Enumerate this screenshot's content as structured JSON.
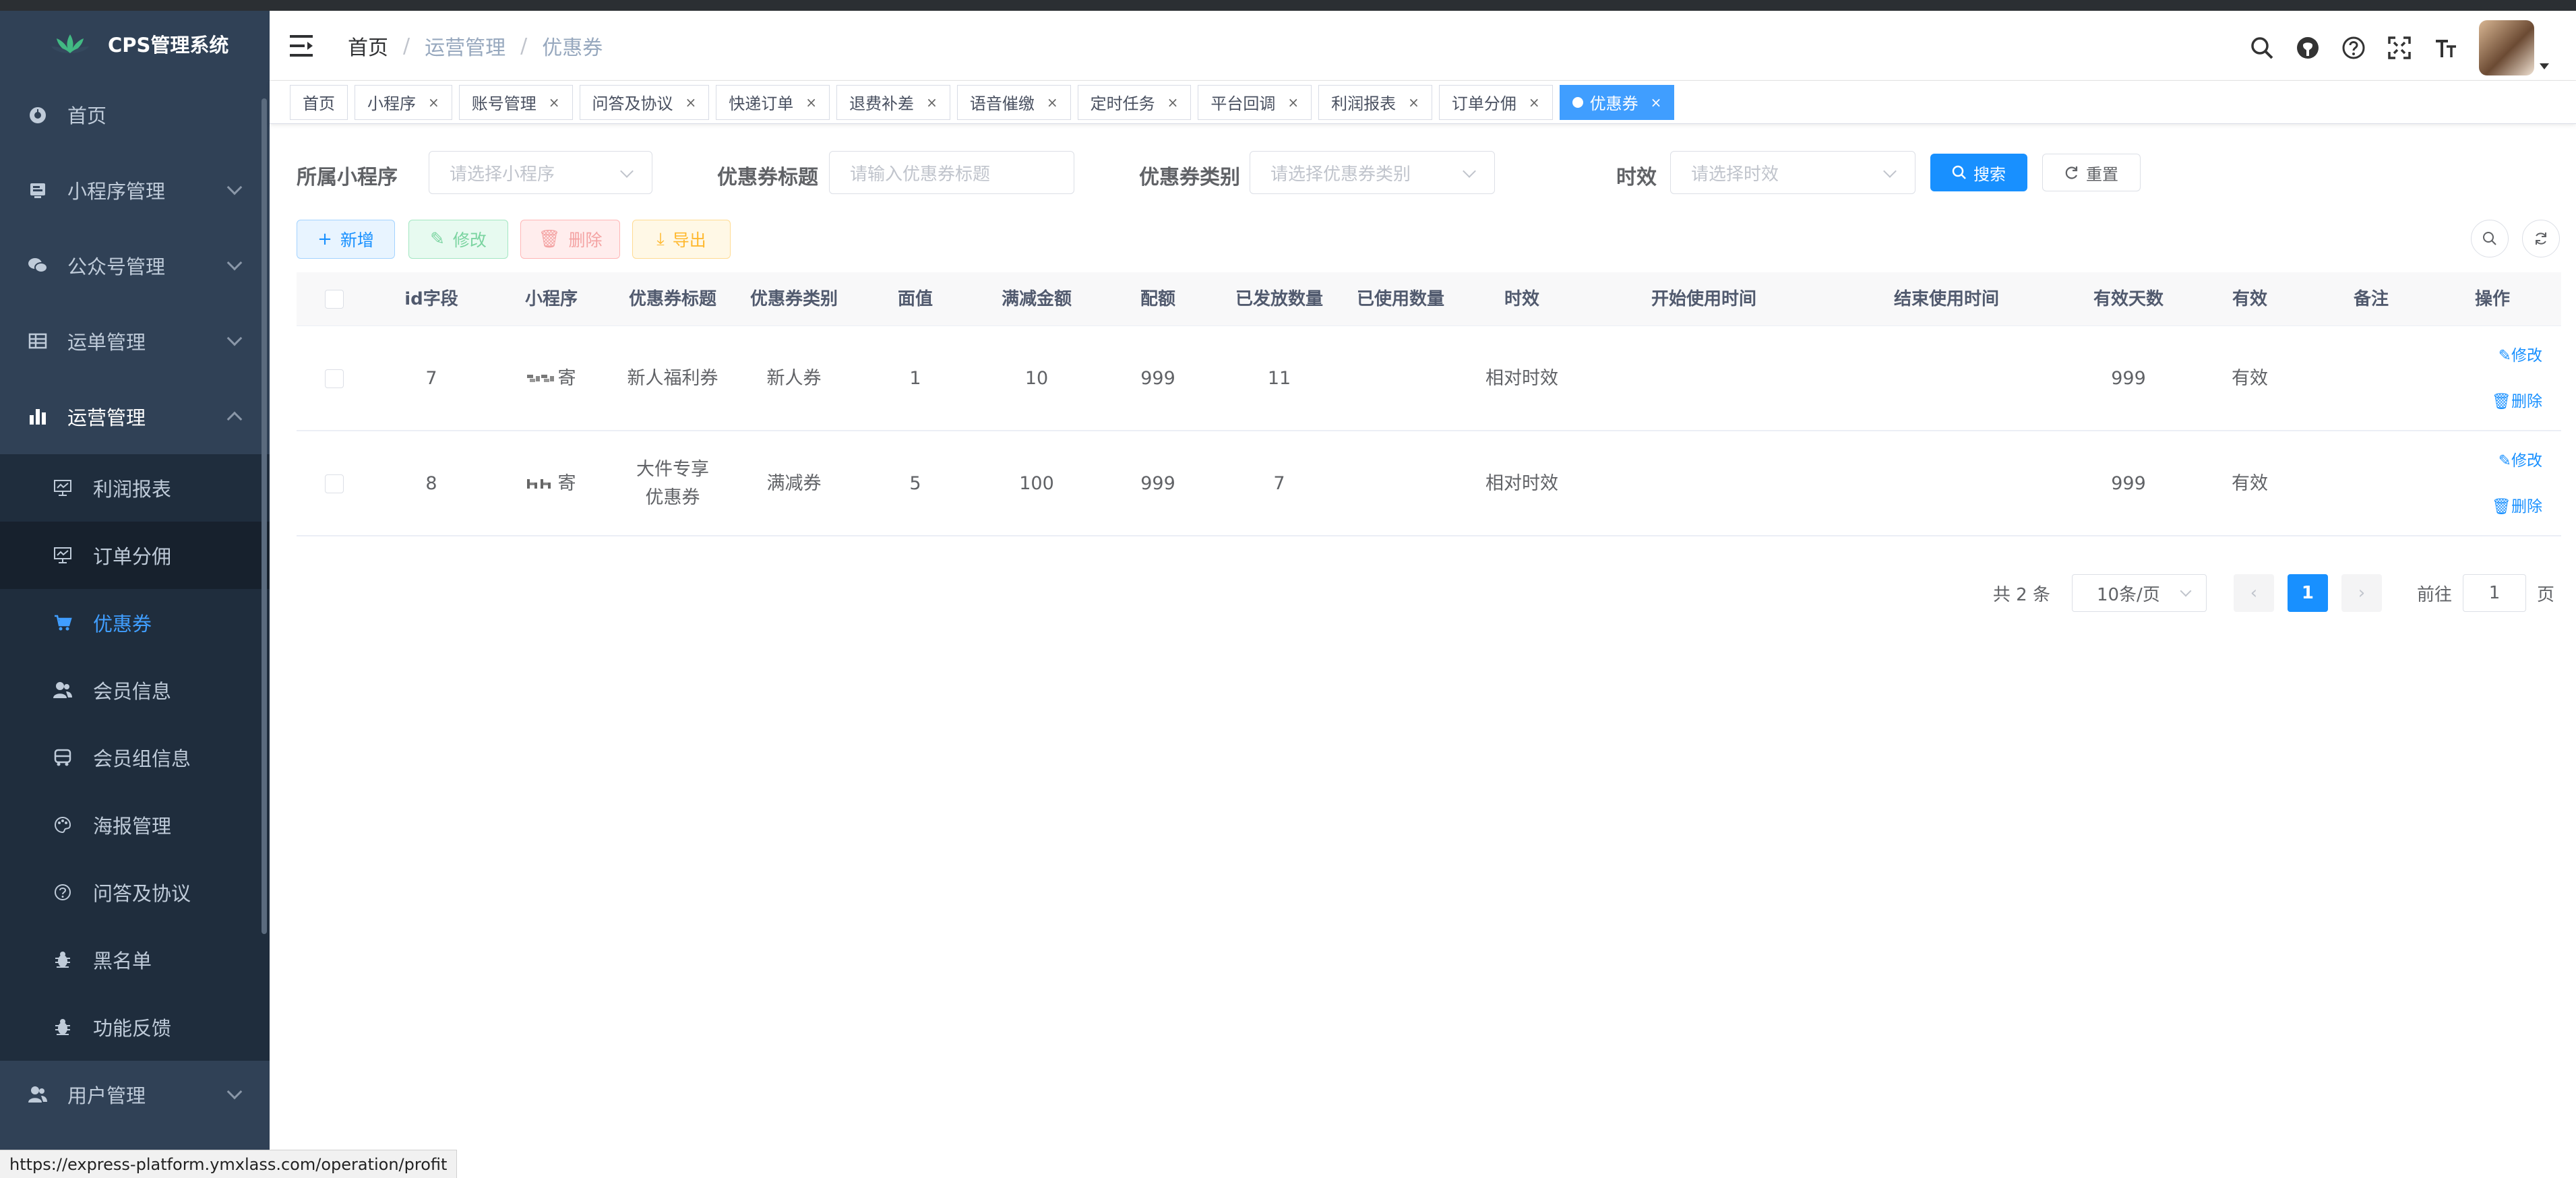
{
  "sidebar": {
    "logo_text": "CPS管理系统",
    "items": [
      {
        "label": "首页",
        "icon": "dashboard-icon"
      },
      {
        "label": "小程序管理",
        "icon": "miniapp-icon"
      },
      {
        "label": "公众号管理",
        "icon": "wechat-icon"
      },
      {
        "label": "运单管理",
        "icon": "table-icon"
      },
      {
        "label": "运营管理",
        "icon": "chart-icon"
      }
    ],
    "sub_items": [
      {
        "label": "利润报表",
        "icon": "monitor-icon"
      },
      {
        "label": "订单分佣",
        "icon": "monitor-icon"
      },
      {
        "label": "优惠券",
        "icon": "cart-icon"
      },
      {
        "label": "会员信息",
        "icon": "peoples-icon"
      },
      {
        "label": "会员组信息",
        "icon": "bus-icon"
      },
      {
        "label": "海报管理",
        "icon": "palette-icon"
      },
      {
        "label": "问答及协议",
        "icon": "question-icon"
      },
      {
        "label": "黑名单",
        "icon": "bug-icon"
      },
      {
        "label": "功能反馈",
        "icon": "bug-icon"
      }
    ],
    "bottom_item": {
      "label": "用户管理",
      "icon": "user-icon"
    }
  },
  "breadcrumb": [
    "首页",
    "运营管理",
    "优惠券"
  ],
  "tags": [
    {
      "label": "首页",
      "closable": false
    },
    {
      "label": "小程序",
      "closable": true
    },
    {
      "label": "账号管理",
      "closable": true
    },
    {
      "label": "问答及协议",
      "closable": true
    },
    {
      "label": "快递订单",
      "closable": true
    },
    {
      "label": "退费补差",
      "closable": true
    },
    {
      "label": "语音催缴",
      "closable": true
    },
    {
      "label": "定时任务",
      "closable": true
    },
    {
      "label": "平台回调",
      "closable": true
    },
    {
      "label": "利润报表",
      "closable": true
    },
    {
      "label": "订单分佣",
      "closable": true
    },
    {
      "label": "优惠券",
      "closable": true,
      "active": true
    }
  ],
  "filters": {
    "miniapp_label": "所属小程序",
    "miniapp_placeholder": "请选择小程序",
    "title_label": "优惠券标题",
    "title_placeholder": "请输入优惠券标题",
    "type_label": "优惠券类别",
    "type_placeholder": "请选择优惠券类别",
    "validity_label": "时效",
    "validity_placeholder": "请选择时效",
    "search_label": "搜索",
    "reset_label": "重置"
  },
  "actions": {
    "add": "新增",
    "edit": "修改",
    "delete": "删除",
    "export": "导出"
  },
  "table": {
    "columns": [
      "id字段",
      "小程序",
      "优惠券标题",
      "优惠券类别",
      "面值",
      "满减金额",
      "配额",
      "已发放数量",
      "已使用数量",
      "时效",
      "开始使用时间",
      "结束使用时间",
      "有效天数",
      "有效",
      "备注",
      "操作"
    ],
    "rows": [
      {
        "id": "7",
        "miniapp": "寄",
        "title": "新人福利券",
        "type": "新人券",
        "face": "1",
        "discount": "10",
        "quota": "999",
        "issued": "11",
        "used": "",
        "validity": "相对时效",
        "start": "",
        "end": "",
        "days": "999",
        "valid": "有效",
        "remark": ""
      },
      {
        "id": "8",
        "miniapp": "寄",
        "title": "大件专享优惠券",
        "type": "满减券",
        "face": "5",
        "discount": "100",
        "quota": "999",
        "issued": "7",
        "used": "",
        "validity": "相对时效",
        "start": "",
        "end": "",
        "days": "999",
        "valid": "有效",
        "remark": ""
      }
    ],
    "row_edit": "修改",
    "row_delete": "删除"
  },
  "pagination": {
    "total": "共 2 条",
    "page_size": "10条/页",
    "current": "1",
    "goto_label": "前往",
    "goto_value": "1",
    "page_suffix": "页"
  },
  "status_url": "https://express-platform.ymxlass.com/operation/profit",
  "colors": {
    "sidebar_bg": "#304156",
    "accent": "#1890ff"
  }
}
